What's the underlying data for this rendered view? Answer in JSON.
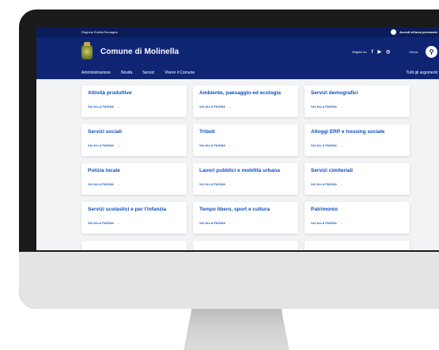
{
  "topbar": {
    "region": "Regione Emilia-Romagna",
    "access": "Accedi all'area personale"
  },
  "header": {
    "site_title": "Comune di Molinella",
    "follow_label": "Seguici su",
    "social_icons": [
      "facebook-icon",
      "youtube-icon",
      "whatsapp-icon"
    ],
    "search_label": "Cerca"
  },
  "nav": {
    "items": [
      "Amministrazione",
      "Novità",
      "Servizi",
      "Vivere il Comune"
    ],
    "right": "Tutti gli argomenti"
  },
  "cards": [
    {
      "title": "Attività produttive",
      "link": "VAI ALLA PAGINA"
    },
    {
      "title": "Ambiente, paesaggio ed ecologia",
      "link": "VAI ALLA PAGINA"
    },
    {
      "title": "Servizi demografici",
      "link": "VAI ALLA PAGINA"
    },
    {
      "title": "Servizi sociali",
      "link": "VAI ALLA PAGINA"
    },
    {
      "title": "Tributi",
      "link": "VAI ALLA PAGINA"
    },
    {
      "title": "Alloggi ERP e housing sociale",
      "link": "VAI ALLA PAGINA"
    },
    {
      "title": "Polizia locale",
      "link": "VAI ALLA PAGINA"
    },
    {
      "title": "Lavori pubblici e mobilità urbana",
      "link": "VAI ALLA PAGINA"
    },
    {
      "title": "Servizi cimiteriali",
      "link": "VAI ALLA PAGINA"
    },
    {
      "title": "Servizi scolastici e per l'infanzia",
      "link": "VAI ALLA PAGINA"
    },
    {
      "title": "Tempo libero, sport e cultura",
      "link": "VAI ALLA PAGINA"
    },
    {
      "title": "Patrimonio",
      "link": "VAI ALLA PAGINA"
    }
  ],
  "colors": {
    "header_dark": "#0a1c5a",
    "header": "#0f2574",
    "link": "#0d4fbf"
  }
}
